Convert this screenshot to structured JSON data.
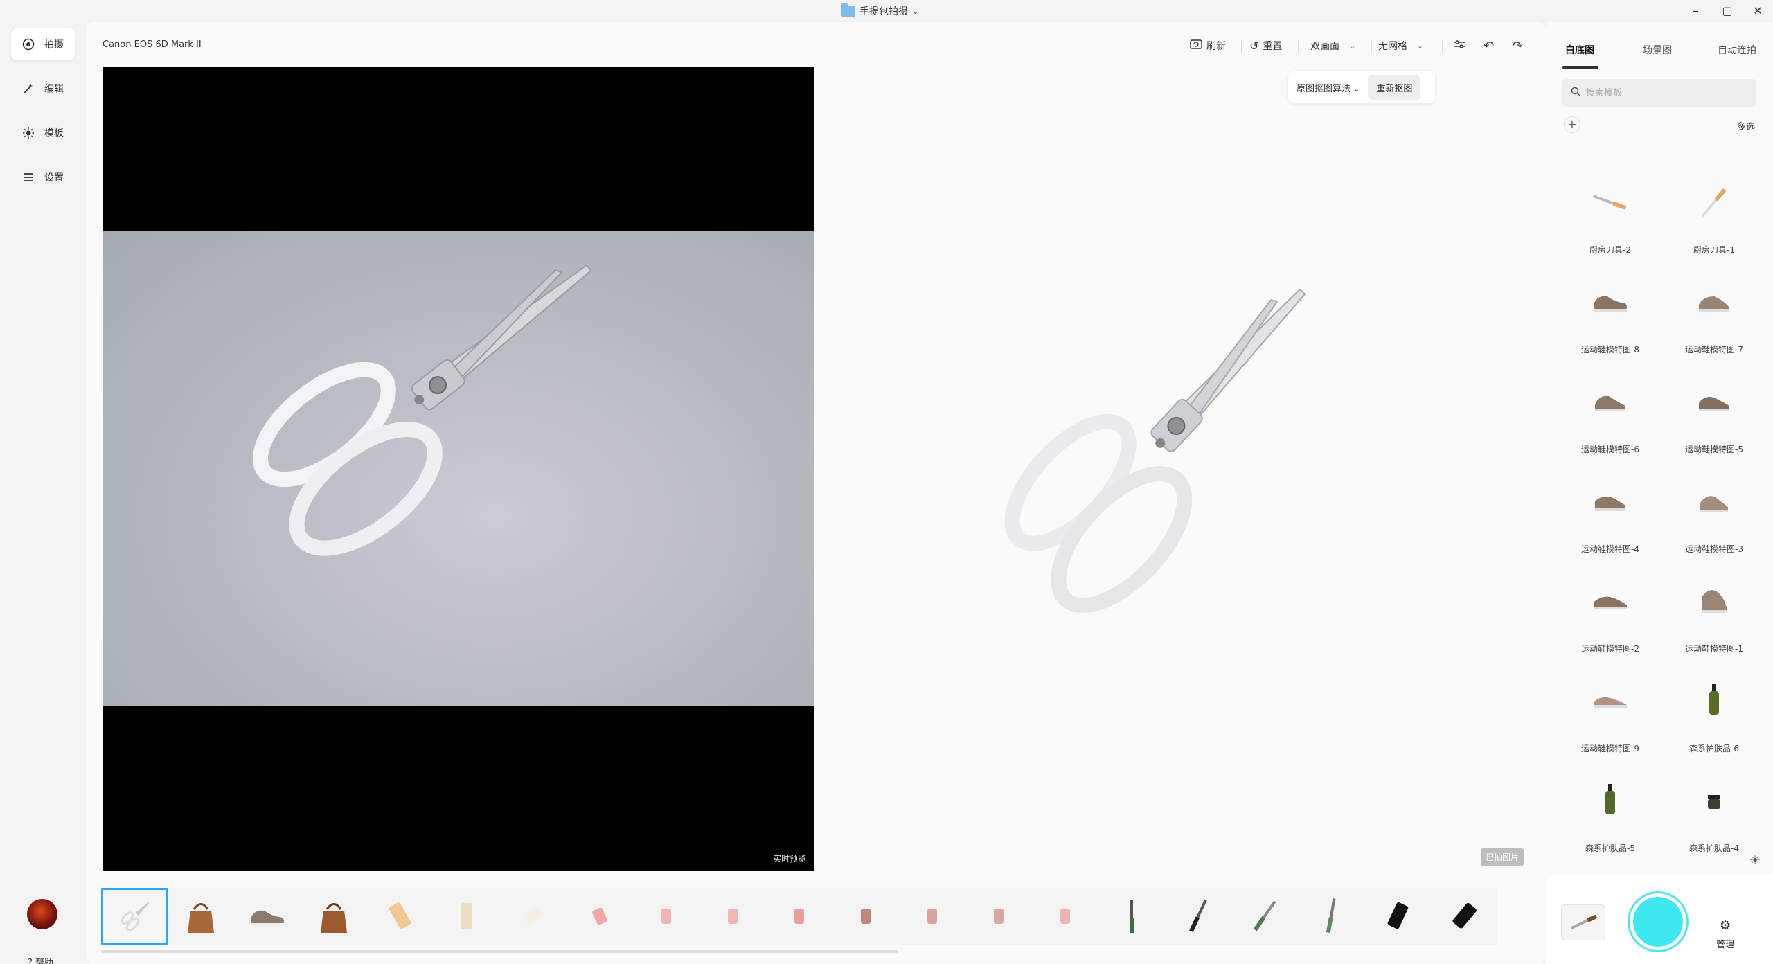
{
  "window": {
    "title": "手提包拍摄",
    "controls": [
      "minimize",
      "maximize",
      "close"
    ]
  },
  "nav": {
    "items": [
      {
        "label": "拍摄",
        "icon": "target-icon",
        "active": true
      },
      {
        "label": "编辑",
        "icon": "magic-wand-icon",
        "active": false
      },
      {
        "label": "模板",
        "icon": "sun-icon",
        "active": false
      },
      {
        "label": "设置",
        "icon": "menu-icon",
        "active": false
      }
    ],
    "help_label": "? 帮助"
  },
  "main": {
    "camera_name": "Canon EOS 6D Mark II",
    "toolbar": {
      "refresh_label": "刷新",
      "reset_label": "重置",
      "view_mode": "双画面",
      "grid_mode": "无网格"
    },
    "live_preview_label": "实时预览",
    "algo_select": "原图抠图算法",
    "rematte_label": "重新抠图",
    "shot_tag": "已拍图片"
  },
  "filmstrip": {
    "items": [
      {
        "kind": "scissors",
        "active": true
      },
      {
        "kind": "handbag-brown"
      },
      {
        "kind": "sneaker"
      },
      {
        "kind": "handbag-brown"
      },
      {
        "kind": "phone-gold-angled"
      },
      {
        "kind": "phone-gold"
      },
      {
        "kind": "phone-white-flat"
      },
      {
        "kind": "phone-pink-angled"
      },
      {
        "kind": "phone-pink"
      },
      {
        "kind": "phone-pink"
      },
      {
        "kind": "phone-pink"
      },
      {
        "kind": "phone-pink-dark"
      },
      {
        "kind": "phone-pink"
      },
      {
        "kind": "phone-pink"
      },
      {
        "kind": "phone-pink"
      },
      {
        "kind": "knife"
      },
      {
        "kind": "knife"
      },
      {
        "kind": "knife"
      },
      {
        "kind": "knife"
      },
      {
        "kind": "phone-black"
      },
      {
        "kind": "phone-black"
      }
    ]
  },
  "rightpanel": {
    "tabs": [
      {
        "label": "白底图",
        "active": true
      },
      {
        "label": "场景图",
        "active": false
      },
      {
        "label": "自动连拍",
        "active": false
      }
    ],
    "search_placeholder": "搜索模板",
    "multi_select_label": "多选",
    "templates": [
      {
        "name": "厨房刀具-2",
        "kind": "knife"
      },
      {
        "name": "厨房刀具-1",
        "kind": "knife"
      },
      {
        "name": "运动鞋模特图-8",
        "kind": "sneaker"
      },
      {
        "name": "运动鞋模特图-7",
        "kind": "sneaker"
      },
      {
        "name": "运动鞋模特图-6",
        "kind": "sneaker"
      },
      {
        "name": "运动鞋模特图-5",
        "kind": "sneaker"
      },
      {
        "name": "运动鞋模特图-4",
        "kind": "sneaker"
      },
      {
        "name": "运动鞋模特图-3",
        "kind": "sneaker"
      },
      {
        "name": "运动鞋模特图-2",
        "kind": "sneaker"
      },
      {
        "name": "运动鞋模特图-1",
        "kind": "sneaker"
      },
      {
        "name": "运动鞋模特图-9",
        "kind": "sneaker"
      },
      {
        "name": "森系护肤品-6",
        "kind": "bottle"
      },
      {
        "name": "森系护肤品-5",
        "kind": "bottle"
      },
      {
        "name": "森系护肤品-4",
        "kind": "jar"
      },
      {
        "name": "",
        "kind": "bottle"
      },
      {
        "name": "",
        "kind": "bottle"
      }
    ],
    "manage_label": "管理"
  },
  "colors": {
    "accent": "#2ea3ff",
    "shutter": "#3de8f0"
  }
}
